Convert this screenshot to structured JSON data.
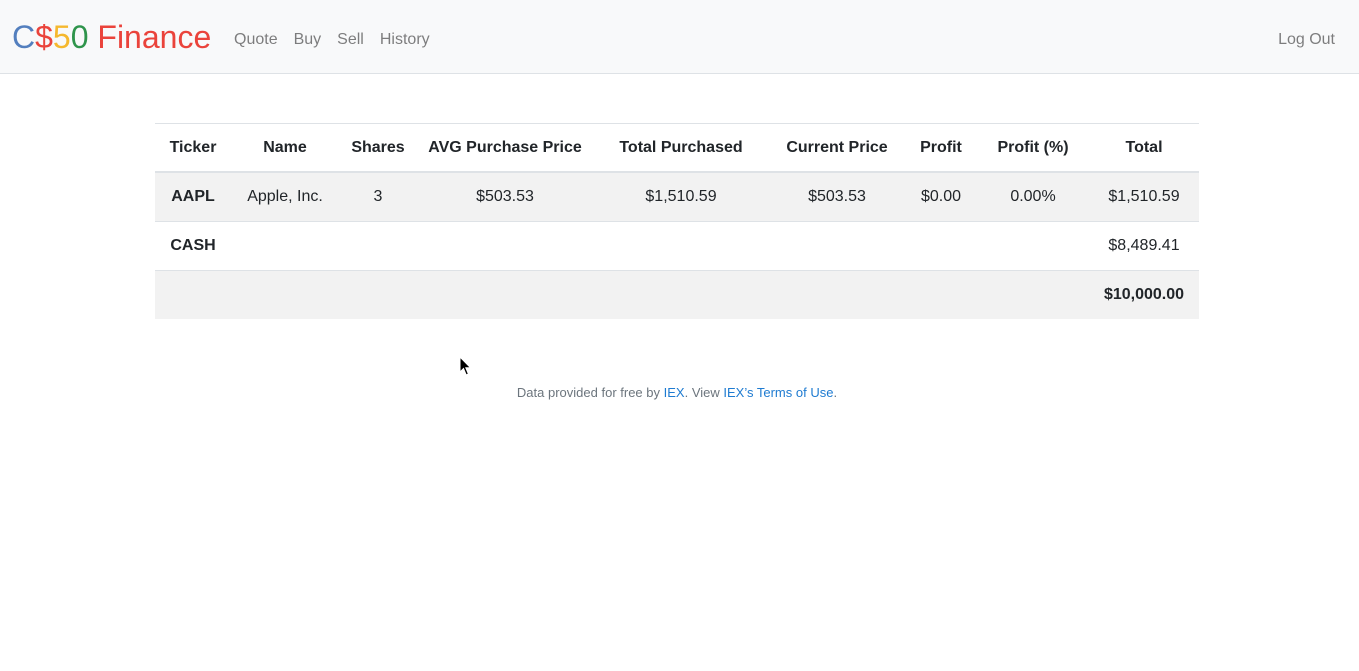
{
  "brand": {
    "parts": [
      {
        "text": "C",
        "color": "#537fbe"
      },
      {
        "text": "$",
        "color": "#ea433b"
      },
      {
        "text": "5",
        "color": "#f5b82e"
      },
      {
        "text": "0",
        "color": "#2e944b"
      },
      {
        "text": " Finance",
        "color": "#ea433b"
      }
    ]
  },
  "nav": {
    "items": [
      "Quote",
      "Buy",
      "Sell",
      "History"
    ],
    "logout": "Log Out"
  },
  "table": {
    "headers": [
      "Ticker",
      "Name",
      "Shares",
      "AVG Purchase Price",
      "Total Purchased",
      "Current Price",
      "Profit",
      "Profit (%)",
      "Total"
    ],
    "rows": [
      [
        "AAPL",
        "Apple, Inc.",
        "3",
        "$503.53",
        "$1,510.59",
        "$503.53",
        "$0.00",
        "0.00%",
        "$1,510.59"
      ]
    ],
    "cash_label": "CASH",
    "cash_value": "$8,489.41",
    "grand_total": "$10,000.00"
  },
  "footer": {
    "prefix": "Data provided for free by ",
    "iex_link": "IEX",
    "middle": ". View ",
    "terms_link": "IEX’s Terms of Use",
    "suffix": "."
  }
}
